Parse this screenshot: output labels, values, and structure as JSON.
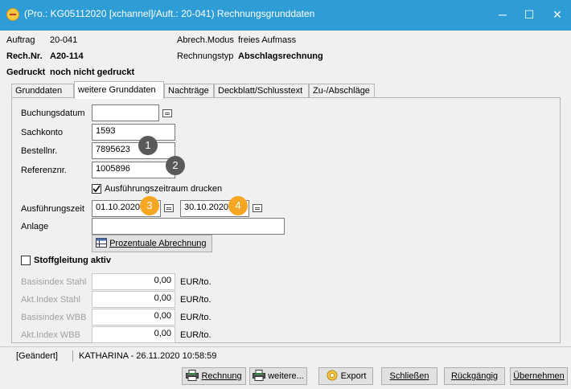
{
  "window": {
    "title": "(Pro.: KG05112020 [xchannel]/Auft.: 20-041) Rechnungsgrunddaten",
    "controls": [
      "─",
      "☐",
      "✕"
    ]
  },
  "header": {
    "auftrag_label": "Auftrag",
    "auftrag_value": "20-041",
    "abrech_label": "Abrech.Modus",
    "abrech_value": "freies Aufmass",
    "rechnr_label": "Rech.Nr.",
    "rechnr_value": "A20-114",
    "rechtyp_label": "Rechnungstyp",
    "rechtyp_value": "Abschlagsrechnung",
    "gedruckt_label": "Gedruckt",
    "gedruckt_value": "noch nicht gedruckt"
  },
  "tabs": [
    {
      "label": "Grunddaten",
      "active": false
    },
    {
      "label": "weitere Grunddaten",
      "active": true
    },
    {
      "label": "Nachträge",
      "active": false
    },
    {
      "label": "Deckblatt/Schlusstext",
      "active": false
    },
    {
      "label": "Zu-/Abschläge",
      "active": false
    }
  ],
  "form": {
    "buchungsdatum_label": "Buchungsdatum",
    "buchungsdatum_value": "",
    "sachkonto_label": "Sachkonto",
    "sachkonto_value": "1593",
    "bestellnr_label": "Bestellnr.",
    "bestellnr_value": "7895623",
    "referenznr_label": "Referenznr.",
    "referenznr_value": "1005896",
    "ausfuehrungszeitraum_check_label": "Ausführungszeitraum drucken",
    "ausfuehrungszeitraum_checked": true,
    "ausfuehrungszeit_label": "Ausführungszeit",
    "ausfuehrungszeit_from": "01.10.2020",
    "ausfuehrungszeit_to": "30.10.2020",
    "anlage_label": "Anlage",
    "anlage_value": "",
    "prozentual_button": "Prozentuale Abrechnung"
  },
  "badges": [
    "1",
    "2",
    "3",
    "4"
  ],
  "stoffgleitung": {
    "check_label": "Stoffgleitung aktiv",
    "checked": false,
    "rows": [
      {
        "label": "Basisindex Stahl",
        "value": "0,00",
        "unit": "EUR/to."
      },
      {
        "label": "Akt.Index Stahl",
        "value": "0,00",
        "unit": "EUR/to."
      },
      {
        "label": "Basisindex WBB",
        "value": "0,00",
        "unit": "EUR/to."
      },
      {
        "label": "Akt.Index WBB",
        "value": "0,00",
        "unit": "EUR/to."
      }
    ]
  },
  "status": {
    "state": "[Geändert]",
    "info": "KATHARINA - 26.11.2020 10:58:59"
  },
  "buttons": {
    "rechnung": "Rechnung",
    "weitere": "weitere...",
    "export": "Export",
    "schliessen": "Schließen",
    "rueckgaengig": "Rückgängig",
    "uebernehmen": "Übernehmen"
  },
  "colors": {
    "titlebar": "#2e9dd6",
    "badge_dark": "#5a5a5a",
    "badge_orange": "#f5a623"
  }
}
